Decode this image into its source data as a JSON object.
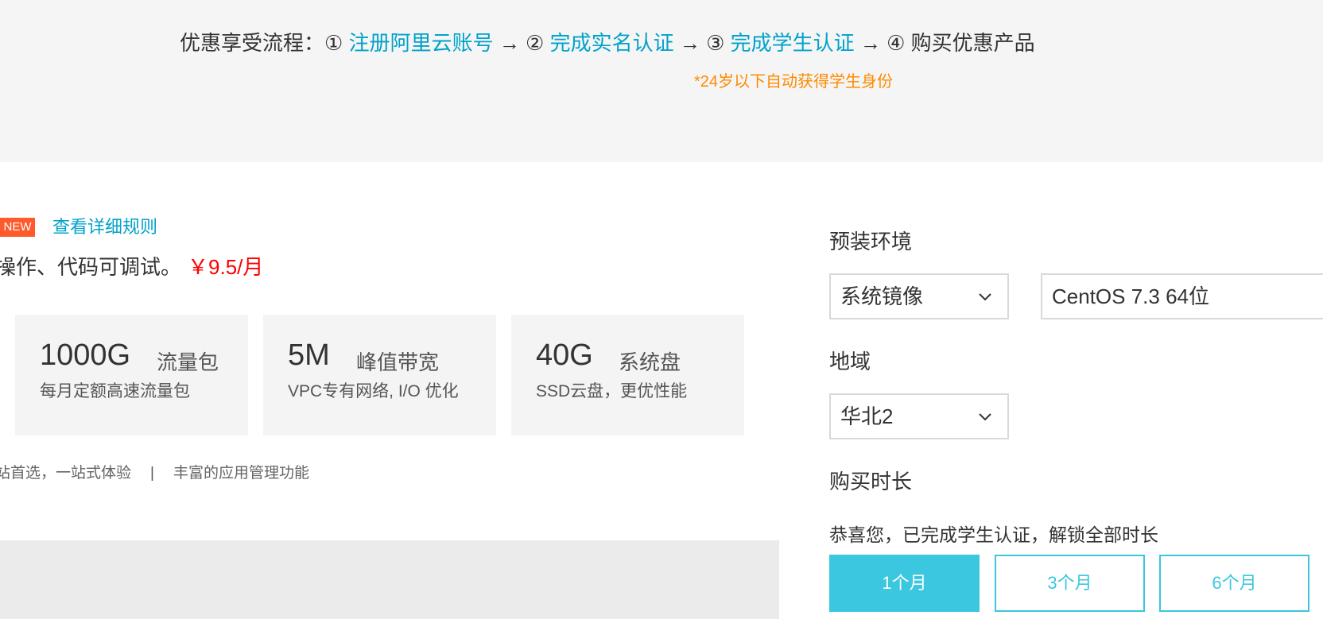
{
  "flow": {
    "prefix": "优惠享受流程：",
    "step1_num": "①",
    "step1_label": "注册阿里云账号",
    "arrow1": "→",
    "step2_num": "②",
    "step2_label": "完成实名认证",
    "arrow2": "→",
    "step3_num": "③",
    "step3_label": "完成学生认证",
    "arrow3": "→",
    "step4_num": "④",
    "step4_label": "购买优惠产品",
    "note": "*24岁以下自动获得学生身份"
  },
  "product": {
    "badge": "NEW",
    "rules_link": "查看详细规则",
    "description": "操作、代码可调试。",
    "price": "￥9.5/月",
    "features": [
      {
        "value": "1000G",
        "unit": "流量包",
        "sub": "每月定额高速流量包"
      },
      {
        "value": "5M",
        "unit": "峰值带宽",
        "sub": "VPC专有网络, I/O 优化"
      },
      {
        "value": "40G",
        "unit": "系统盘",
        "sub": "SSD云盘，更优性能"
      }
    ],
    "extra_1": "站首选，一站式体验",
    "extra_sep": "|",
    "extra_2": "丰富的应用管理功能"
  },
  "config": {
    "env_label": "预装环境",
    "image_type": "系统镜像",
    "os": "CentOS 7.3 64位",
    "region_label": "地域",
    "region": "华北2",
    "duration_label": "购买时长",
    "congrats": "恭喜您，已完成学生认证，解锁全部时长",
    "durations": [
      "1个月",
      "3个月",
      "6个月"
    ],
    "selected_duration": "1个月",
    "accent_color": "#3ac7df",
    "link_color": "#00a2ca",
    "price_color": "#ff0000",
    "note_color": "#ff8a00"
  }
}
